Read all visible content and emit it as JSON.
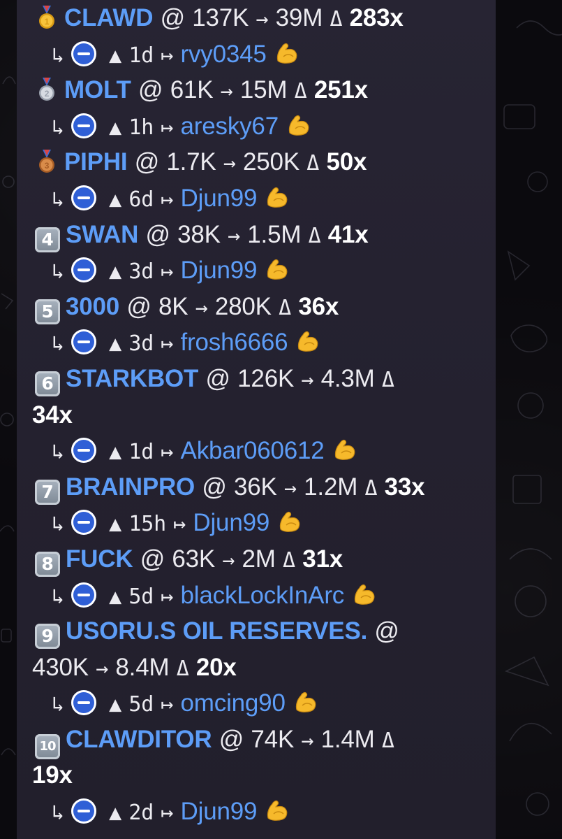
{
  "rows": [
    {
      "rank": "1",
      "medal": "gold",
      "ticker": "CLAWD",
      "at": "@",
      "from": "137K",
      "arrow": "→",
      "to": "39M",
      "delta": "Δ",
      "mult": "283x",
      "reply": "↳",
      "up": "▲",
      "age": "1d",
      "link": "↦",
      "user": "rvy0345"
    },
    {
      "rank": "2",
      "medal": "silver",
      "ticker": "MOLT",
      "at": "@",
      "from": "61K",
      "arrow": "→",
      "to": "15M",
      "delta": "Δ",
      "mult": "251x",
      "reply": "↳",
      "up": "▲",
      "age": "1h",
      "link": "↦",
      "user": "aresky67"
    },
    {
      "rank": "3",
      "medal": "bronze",
      "ticker": "PIPHI",
      "at": "@",
      "from": "1.7K",
      "arrow": "→",
      "to": "250K",
      "delta": "Δ",
      "mult": "50x",
      "reply": "↳",
      "up": "▲",
      "age": "6d",
      "link": "↦",
      "user": "Djun99"
    },
    {
      "rank": "4",
      "ticker": "SWAN",
      "at": "@",
      "from": "38K",
      "arrow": "→",
      "to": "1.5M",
      "delta": "Δ",
      "mult": "41x",
      "reply": "↳",
      "up": "▲",
      "age": "3d",
      "link": "↦",
      "user": "Djun99"
    },
    {
      "rank": "5",
      "ticker": "3000",
      "at": "@",
      "from": "8K",
      "arrow": "→",
      "to": "280K",
      "delta": "Δ",
      "mult": "36x",
      "reply": "↳",
      "up": "▲",
      "age": "3d",
      "link": "↦",
      "user": "frosh6666"
    },
    {
      "rank": "6",
      "ticker": "STARKBOT",
      "at": "@",
      "from": "126K",
      "arrow": "→",
      "to": "4.3M",
      "delta": "Δ",
      "mult": "34x",
      "reply": "↳",
      "up": "▲",
      "age": "1d",
      "link": "↦",
      "user": "Akbar060612"
    },
    {
      "rank": "7",
      "ticker": "BRAINPRO",
      "at": "@",
      "from": "36K",
      "arrow": "→",
      "to": "1.2M",
      "delta": "Δ",
      "mult": "33x",
      "reply": "↳",
      "up": "▲",
      "age": "15h",
      "link": "↦",
      "user": "Djun99"
    },
    {
      "rank": "8",
      "ticker": "FUCK",
      "at": "@",
      "from": "63K",
      "arrow": "→",
      "to": "2M",
      "delta": "Δ",
      "mult": "31x",
      "reply": "↳",
      "up": "▲",
      "age": "5d",
      "link": "↦",
      "user": "blackLockInArc"
    },
    {
      "rank": "9",
      "ticker": "USORU.S OIL RESERVES.",
      "at": "@",
      "from": "430K",
      "arrow": "→",
      "to": "8.4M",
      "delta": "Δ",
      "mult": "20x",
      "reply": "↳",
      "up": "▲",
      "age": "5d",
      "link": "↦",
      "user": "omcing90"
    },
    {
      "rank": "10",
      "ticker": "CLAWDITOR",
      "at": "@",
      "from": "74K",
      "arrow": "→",
      "to": "1.4M",
      "delta": "Δ",
      "mult": "19x",
      "reply": "↳",
      "up": "▲",
      "age": "2d",
      "link": "↦",
      "user": "Djun99"
    }
  ],
  "colors": {
    "link": "#5d9df7",
    "text": "#ecebf0",
    "bubble": "#25222f",
    "background": "#0b0a0e"
  },
  "icons": {
    "gold": "first-place-medal-icon",
    "silver": "second-place-medal-icon",
    "bronze": "third-place-medal-icon",
    "status": "minus-circle-icon",
    "flex": "flexed-biceps-icon"
  }
}
